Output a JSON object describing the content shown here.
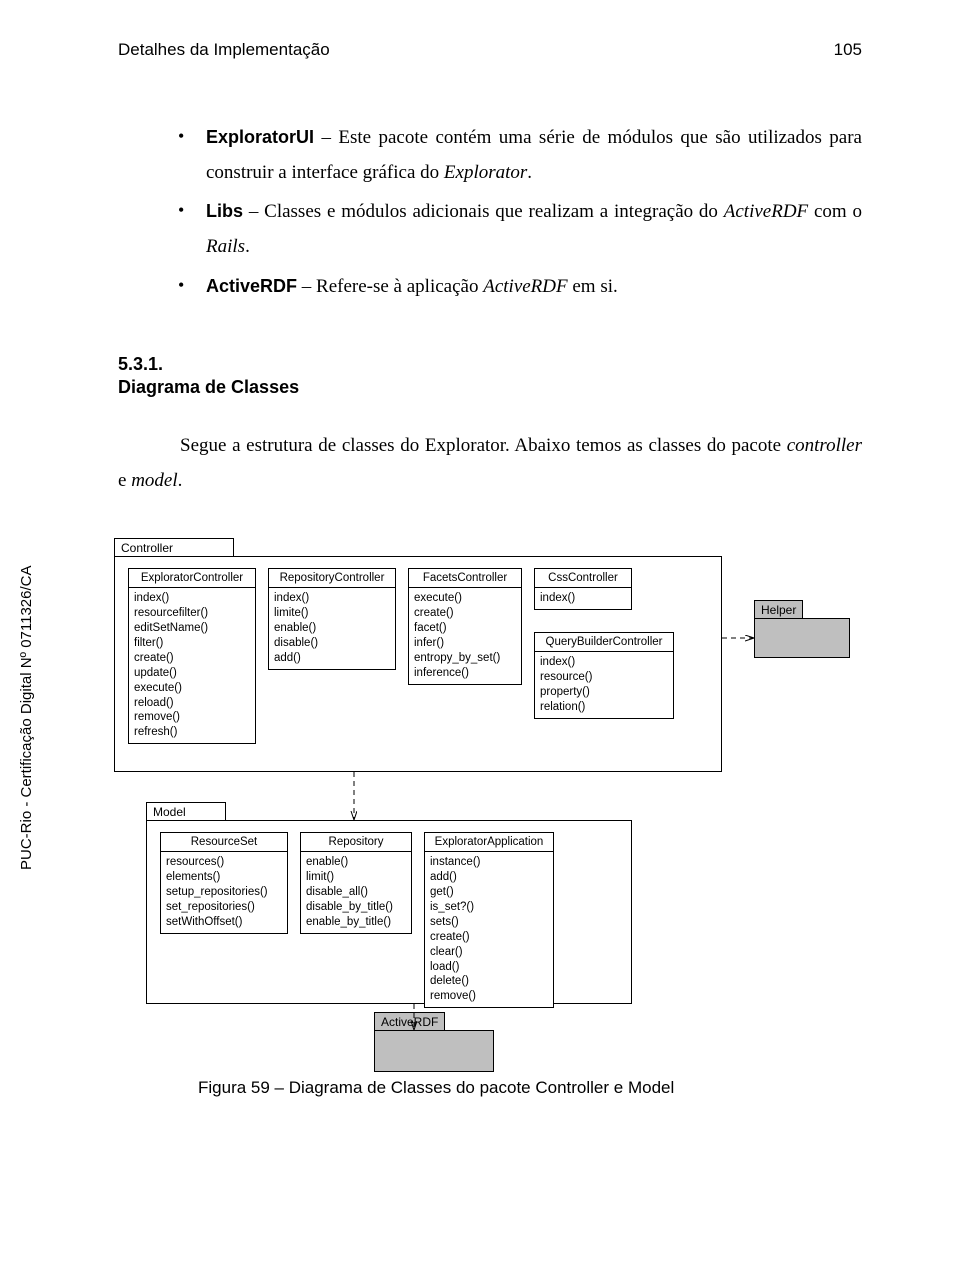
{
  "header": {
    "left": "Detalhes da Implementação",
    "right": "105"
  },
  "bullets": {
    "b1_bold": "ExploratorUI",
    "b1_rest": " – Este pacote contém uma série de módulos que são utilizados para construir a interface gráfica do ",
    "b1_it": "Explorator",
    "b1_end": ".",
    "b2_bold": "Libs",
    "b2_rest": " – Classes e módulos adicionais que realizam a integração do ",
    "b2_it1": "ActiveRDF",
    "b2_mid": " com o ",
    "b2_it2": "Rails",
    "b2_end": ".",
    "b3_bold": "ActiveRDF",
    "b3_rest": " – Refere-se à aplicação ",
    "b3_it": "ActiveRDF",
    "b3_end": " em si."
  },
  "section": {
    "num": "5.3.1.",
    "title": "Diagrama de Classes"
  },
  "para": {
    "p1": "Segue a estrutura de classes do Explorator. Abaixo temos as classes do pacote ",
    "p1_it1": "controller",
    "p1_mid": " e ",
    "p1_it2": "model",
    "p1_end": "."
  },
  "diagram": {
    "controller_label": "Controller",
    "model_label": "Model",
    "helper_label": "Helper",
    "activerdf_label": "ActiveRDF",
    "classes": {
      "explorator_controller": {
        "title": "ExploratorController",
        "methods": [
          "index()",
          "resourcefilter()",
          "editSetName()",
          "filter()",
          "create()",
          "update()",
          "execute()",
          "reload()",
          "remove()",
          "refresh()"
        ]
      },
      "repository_controller": {
        "title": "RepositoryController",
        "methods": [
          "index()",
          "limite()",
          "enable()",
          "disable()",
          "add()"
        ]
      },
      "facets_controller": {
        "title": "FacetsController",
        "methods": [
          "execute()",
          "create()",
          "facet()",
          "infer()",
          "entropy_by_set()",
          "inference()"
        ]
      },
      "css_controller": {
        "title": "CssController",
        "methods": [
          "index()"
        ]
      },
      "querybuilder_controller": {
        "title": "QueryBuilderController",
        "methods": [
          "index()",
          "resource()",
          "property()",
          "relation()"
        ]
      },
      "resource_set": {
        "title": "ResourceSet",
        "methods": [
          "resources()",
          "elements()",
          "setup_repositories()",
          "set_repositories()",
          "setWithOffset()"
        ]
      },
      "repository": {
        "title": "Repository",
        "methods": [
          "enable()",
          "limit()",
          "disable_all()",
          "disable_by_title()",
          "enable_by_title()"
        ]
      },
      "explorator_application": {
        "title": "ExploratorApplication",
        "methods": [
          "instance()",
          "add()",
          "get()",
          "is_set?()",
          "sets()",
          "create()",
          "clear()",
          "load()",
          "delete()",
          "remove()"
        ]
      }
    }
  },
  "sidelabel": "PUC-Rio - Certificação Digital Nº 0711326/CA",
  "caption": "Figura 59 – Diagrama de Classes do pacote Controller e Model"
}
